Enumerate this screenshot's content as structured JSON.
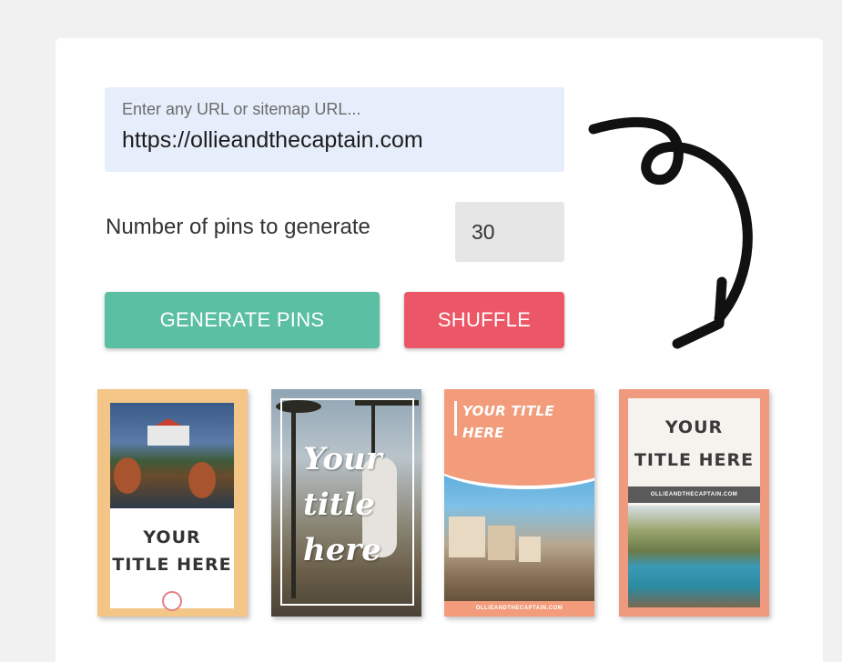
{
  "form": {
    "url_placeholder": "Enter any URL or sitemap URL...",
    "url_value": "https://ollieandthecaptain.com",
    "pins_label": "Number of pins to generate",
    "pins_value": "30",
    "generate_label": "GENERATE PINS",
    "shuffle_label": "SHUFFLE"
  },
  "colors": {
    "generate": "#5bbfa3",
    "shuffle": "#ec5767",
    "url_box": "#e6eefb"
  },
  "pins": [
    {
      "title_line1": "YOUR",
      "title_line2": "TITLE HERE"
    },
    {
      "title_line1": "Your",
      "title_line2": "title",
      "title_line3": "here"
    },
    {
      "title_line1": "YOUR TITLE",
      "title_line2": "HERE",
      "footer": "OLLIEANDTHECAPTAIN.COM"
    },
    {
      "title_line1": "YOUR",
      "title_line2": "TITLE HERE",
      "band": "OLLIEANDTHECAPTAIN.COM"
    }
  ],
  "decor": {
    "arrow": "curly-arrow-icon"
  }
}
